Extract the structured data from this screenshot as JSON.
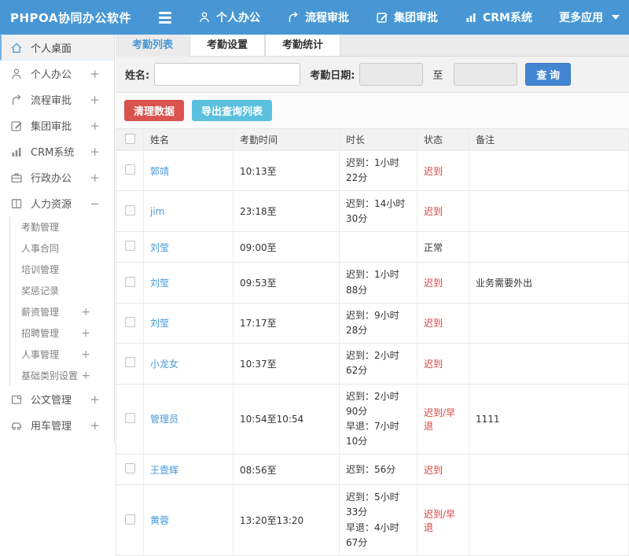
{
  "colors": {
    "header_bg": "#4897d4",
    "accent_blue": "#4897d4",
    "search_button": "#4285d3",
    "danger_red": "#d9534f",
    "info_teal": "#5bc0de",
    "link_blue": "#4898d8",
    "status_red": "#d6413d"
  },
  "header": {
    "logo": "PHPOA协同办公软件",
    "nav": [
      {
        "label": "个人办公",
        "icon": "user-icon"
      },
      {
        "label": "流程审批",
        "icon": "flow-icon"
      },
      {
        "label": "集团审批",
        "icon": "edit-icon"
      },
      {
        "label": "CRM系统",
        "icon": "chart-icon"
      },
      {
        "label": "更多应用",
        "icon": "caret-down-icon"
      }
    ]
  },
  "sidebar": {
    "items": [
      {
        "label": "个人桌面",
        "icon": "home-icon",
        "expand": ""
      },
      {
        "label": "个人办公",
        "icon": "user-icon",
        "expand": "+"
      },
      {
        "label": "流程审批",
        "icon": "flow-icon",
        "expand": "+"
      },
      {
        "label": "集团审批",
        "icon": "edit-icon",
        "expand": "+"
      },
      {
        "label": "CRM系统",
        "icon": "chart-icon",
        "expand": "+"
      },
      {
        "label": "行政办公",
        "icon": "briefcase-icon",
        "expand": "+"
      },
      {
        "label": "人力资源",
        "icon": "book-icon",
        "expand": "−"
      }
    ],
    "hr_subitems": [
      {
        "label": "考勤管理",
        "expand": ""
      },
      {
        "label": "人事合同",
        "expand": ""
      },
      {
        "label": "培训管理",
        "expand": ""
      },
      {
        "label": "奖惩记录",
        "expand": ""
      },
      {
        "label": "薪资管理",
        "expand": "+"
      },
      {
        "label": "招聘管理",
        "expand": "+"
      },
      {
        "label": "人事管理",
        "expand": "+"
      },
      {
        "label": "基础类别设置",
        "expand": "+"
      }
    ],
    "bottom_items": [
      {
        "label": "公文管理",
        "icon": "document-icon",
        "expand": "+"
      },
      {
        "label": "用车管理",
        "icon": "car-icon",
        "expand": "+"
      }
    ]
  },
  "tabs": [
    {
      "label": "考勤列表",
      "active": true
    },
    {
      "label": "考勤设置",
      "active": false
    },
    {
      "label": "考勤统计",
      "active": false
    }
  ],
  "filter": {
    "name_label": "姓名:",
    "date_label": "考勤日期:",
    "to_label": "至",
    "search_button": "查 询"
  },
  "actions": {
    "clear_button": "清理数据",
    "export_button": "导出查询列表"
  },
  "table": {
    "columns": [
      "姓名",
      "考勤时间",
      "时长",
      "状态",
      "备注"
    ],
    "rows": [
      {
        "name": "郭靖",
        "time": "10:13至",
        "duration": "迟到：1小时22分",
        "status": "迟到",
        "note": ""
      },
      {
        "name": "jim",
        "time": "23:18至",
        "duration": "迟到：14小时30分",
        "status": "迟到",
        "note": ""
      },
      {
        "name": "刘莹",
        "time": "09:00至",
        "duration": "",
        "status": "正常",
        "note": ""
      },
      {
        "name": "刘莹",
        "time": "09:53至",
        "duration": "迟到：1小时88分",
        "status": "迟到",
        "note": "业务需要外出"
      },
      {
        "name": "刘莹",
        "time": "17:17至",
        "duration": "迟到：9小时28分",
        "status": "迟到",
        "note": ""
      },
      {
        "name": "小龙女",
        "time": "10:37至",
        "duration": "迟到：2小时62分",
        "status": "迟到",
        "note": ""
      },
      {
        "name": "管理员",
        "time": "10:54至10:54",
        "duration": "迟到：2小时90分\n早退：7小时10分",
        "status": "迟到/早退",
        "note": "1111"
      },
      {
        "name": "王壹辉",
        "time": "08:56至",
        "duration": "迟到：56分",
        "status": "迟到",
        "note": ""
      },
      {
        "name": "黄蓉",
        "time": "13:20至13:20",
        "duration": "迟到：5小时33分\n早退：4小时67分",
        "status": "迟到/早退",
        "note": ""
      }
    ]
  }
}
